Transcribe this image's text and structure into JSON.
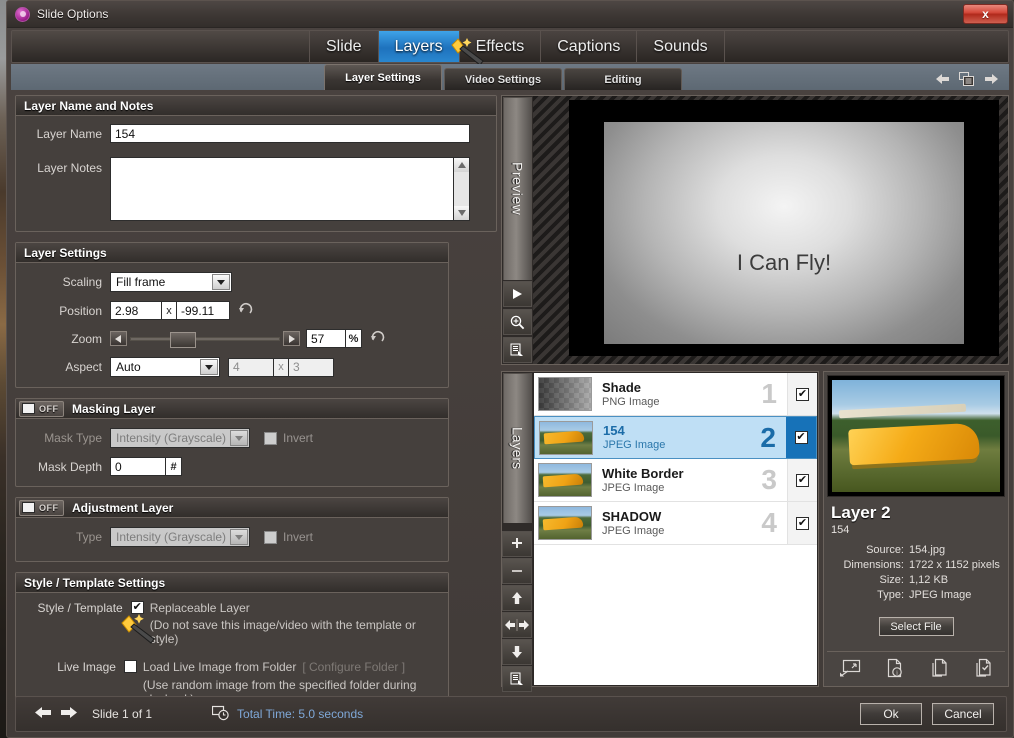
{
  "window": {
    "title": "Slide Options",
    "app_icon": "app-logo-icon",
    "close_label": "x"
  },
  "main_tabs": [
    {
      "label": "Slide",
      "active": false
    },
    {
      "label": "Layers",
      "active": true
    },
    {
      "label": "Effects",
      "active": false
    },
    {
      "label": "Captions",
      "active": false
    },
    {
      "label": "Sounds",
      "active": false
    }
  ],
  "sub_tabs": [
    {
      "label": "Layer Settings",
      "active": true
    },
    {
      "label": "Video Settings",
      "active": false
    },
    {
      "label": "Editing",
      "active": false
    }
  ],
  "sub_nav": {
    "prev_icon": "arrow-left-icon",
    "copy_icon": "copy-icon",
    "next_icon": "arrow-right-icon"
  },
  "layer_name_notes": {
    "title": "Layer Name and Notes",
    "layer_name_label": "Layer Name",
    "layer_name_value": "154",
    "layer_notes_label": "Layer Notes",
    "layer_notes_value": "",
    "layer_notes_placeholder": ""
  },
  "layer_settings": {
    "title": "Layer Settings",
    "scaling_label": "Scaling",
    "scaling_value": "Fill frame",
    "position_label": "Position",
    "position_x": "2.98",
    "position_sep": "x",
    "position_y": "-99.11",
    "zoom_label": "Zoom",
    "zoom_value": "57",
    "zoom_unit": "%",
    "zoom_percent": 57,
    "aspect_label": "Aspect",
    "aspect_value": "Auto",
    "aspect_w": "4",
    "aspect_sep": "x",
    "aspect_h": "3",
    "reset_icon": "reset-arrow-icon"
  },
  "masking_layer": {
    "title": "Masking Layer",
    "toggle_state": "OFF",
    "mask_type_label": "Mask Type",
    "mask_type_value": "Intensity (Grayscale)",
    "invert_label": "Invert",
    "invert_checked": false,
    "mask_depth_label": "Mask Depth",
    "mask_depth_value": "0",
    "mask_depth_unit": "#"
  },
  "adjustment_layer": {
    "title": "Adjustment Layer",
    "toggle_state": "OFF",
    "type_label": "Type",
    "type_value": "Intensity (Grayscale)",
    "invert_label": "Invert",
    "invert_checked": false
  },
  "style_template": {
    "title": "Style / Template Settings",
    "style_label": "Style / Template",
    "replaceable_label": "Replaceable Layer",
    "replaceable_checked": true,
    "replaceable_note": "(Do not save this image/video with the template or style)",
    "live_image_label": "Live Image",
    "live_image_checkbox_label": "Load Live Image from Folder",
    "live_image_checked": false,
    "configure_folder_label": "[ Configure Folder ]",
    "live_image_note": "(Use random image from the specified folder during playback)"
  },
  "preview": {
    "rail_label": "Preview",
    "caption": "I Can Fly!",
    "buttons": [
      {
        "name": "play-icon"
      },
      {
        "name": "zoom-in-icon"
      },
      {
        "name": "menu-icon"
      }
    ]
  },
  "layers_panel": {
    "rail_label": "Layers",
    "rows": [
      {
        "name": "Shade",
        "type": "PNG Image",
        "number": "1",
        "checked": true,
        "selected": false,
        "thumb": "checker-gradient-thumb"
      },
      {
        "name": "154",
        "type": "JPEG Image",
        "number": "2",
        "checked": true,
        "selected": true,
        "thumb": "biplane-thumb"
      },
      {
        "name": "White Border",
        "type": "JPEG Image",
        "number": "3",
        "checked": true,
        "selected": false,
        "thumb": "biplane-thumb"
      },
      {
        "name": "SHADOW",
        "type": "JPEG Image",
        "number": "4",
        "checked": true,
        "selected": false,
        "thumb": "biplane-thumb"
      }
    ],
    "buttons": [
      {
        "name": "add-layer-icon"
      },
      {
        "name": "remove-layer-icon"
      },
      {
        "name": "move-up-icon"
      },
      {
        "name": "move-horizontal-icon"
      },
      {
        "name": "move-down-icon"
      },
      {
        "name": "layer-menu-icon"
      }
    ]
  },
  "detail_panel": {
    "title": "Layer 2",
    "subtitle": "154",
    "fields": [
      {
        "key": "Source:",
        "value": "154.jpg"
      },
      {
        "key": "Dimensions:",
        "value": "1722 x 1152 pixels"
      },
      {
        "key": "Size:",
        "value": "1,12 KB"
      },
      {
        "key": "Type:",
        "value": "JPEG Image"
      }
    ],
    "select_file_label": "Select File",
    "icons": [
      {
        "name": "transform-image-icon"
      },
      {
        "name": "file-info-icon"
      },
      {
        "name": "copy-file-icon"
      },
      {
        "name": "apply-file-icon"
      }
    ]
  },
  "statusbar": {
    "prev_icon": "arrow-left-icon",
    "next_icon": "arrow-right-icon",
    "slide_count": "Slide 1 of 1",
    "clock_icon": "slide-clock-icon",
    "total_time": "Total Time: 5.0 seconds",
    "ok_label": "Ok",
    "cancel_label": "Cancel"
  },
  "colors": {
    "accent_blue": "#1e72bd",
    "selection_blue": "#bfdff5",
    "panel_bg": "#45403d",
    "close_red": "#d4483a",
    "link_blue": "#7fa8d8"
  }
}
